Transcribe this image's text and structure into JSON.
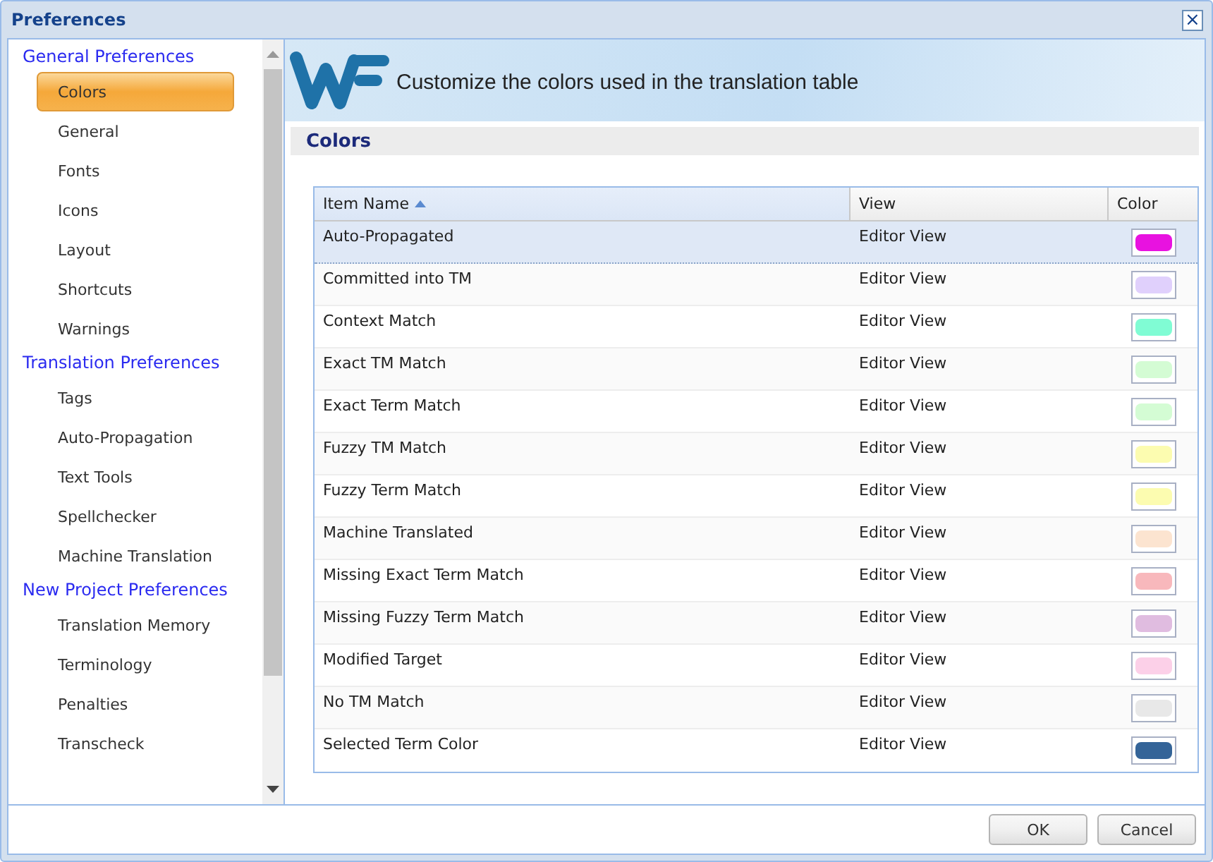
{
  "window": {
    "title": "Preferences",
    "close": "×"
  },
  "sidebar": {
    "groups": [
      {
        "label": "General Preferences",
        "items": [
          {
            "label": "Colors",
            "selected": true
          },
          {
            "label": "General",
            "selected": false
          },
          {
            "label": "Fonts",
            "selected": false
          },
          {
            "label": "Icons",
            "selected": false
          },
          {
            "label": "Layout",
            "selected": false
          },
          {
            "label": "Shortcuts",
            "selected": false
          },
          {
            "label": "Warnings",
            "selected": false
          }
        ]
      },
      {
        "label": "Translation Preferences",
        "items": [
          {
            "label": "Tags",
            "selected": false
          },
          {
            "label": "Auto-Propagation",
            "selected": false
          },
          {
            "label": "Text Tools",
            "selected": false
          },
          {
            "label": "Spellchecker",
            "selected": false
          },
          {
            "label": "Machine Translation",
            "selected": false
          }
        ]
      },
      {
        "label": "New Project Preferences",
        "items": [
          {
            "label": "Translation Memory",
            "selected": false
          },
          {
            "label": "Terminology",
            "selected": false
          },
          {
            "label": "Penalties",
            "selected": false
          },
          {
            "label": "Transcheck",
            "selected": false
          }
        ]
      }
    ]
  },
  "header": {
    "text": "Customize the colors used in the translation table"
  },
  "section": {
    "title": "Colors"
  },
  "table": {
    "columns": [
      {
        "label": "Item Name",
        "sorted": true
      },
      {
        "label": "View",
        "sorted": false
      },
      {
        "label": "Color",
        "sorted": false
      }
    ],
    "rows": [
      {
        "name": "Auto-Propagated",
        "view": "Editor View",
        "color": "#e812e0",
        "selected": true
      },
      {
        "name": "Committed into TM",
        "view": "Editor View",
        "color": "#e0d0fc",
        "selected": false
      },
      {
        "name": "Context Match",
        "view": "Editor View",
        "color": "#80fcd4",
        "selected": false
      },
      {
        "name": "Exact TM Match",
        "view": "Editor View",
        "color": "#d4fcd4",
        "selected": false
      },
      {
        "name": "Exact Term Match",
        "view": "Editor View",
        "color": "#d4fcd4",
        "selected": false
      },
      {
        "name": "Fuzzy TM Match",
        "view": "Editor View",
        "color": "#fcfcb0",
        "selected": false
      },
      {
        "name": "Fuzzy Term Match",
        "view": "Editor View",
        "color": "#fcfcb0",
        "selected": false
      },
      {
        "name": "Machine Translated",
        "view": "Editor View",
        "color": "#fce4d0",
        "selected": false
      },
      {
        "name": "Missing Exact Term Match",
        "view": "Editor View",
        "color": "#f8b8bc",
        "selected": false
      },
      {
        "name": "Missing Fuzzy Term Match",
        "view": "Editor View",
        "color": "#e0bce0",
        "selected": false
      },
      {
        "name": "Modified Target",
        "view": "Editor View",
        "color": "#fcd0e8",
        "selected": false
      },
      {
        "name": "No TM Match",
        "view": "Editor View",
        "color": "#e8e8e8",
        "selected": false
      },
      {
        "name": "Selected Term Color",
        "view": "Editor View",
        "color": "#346498",
        "selected": false
      }
    ]
  },
  "buttons": [
    "OK",
    "Cancel"
  ]
}
